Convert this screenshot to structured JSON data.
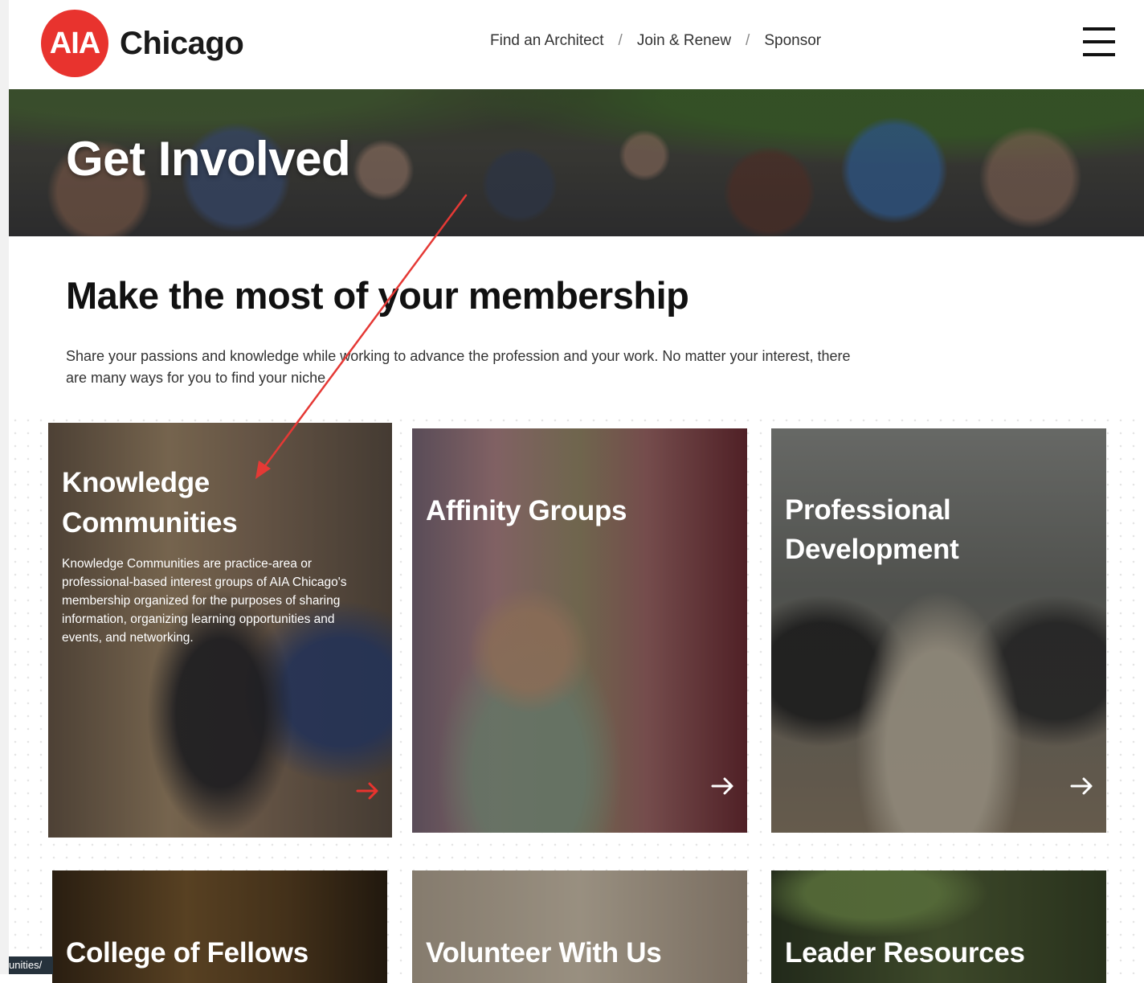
{
  "brand": {
    "logo_mark": "AIA",
    "logo_word": "Chicago",
    "accent": "#e8332e"
  },
  "nav": {
    "items": [
      "Find an Architect",
      "Join & Renew",
      "Sponsor"
    ],
    "separator": "/",
    "menu_icon": "hamburger-menu-icon"
  },
  "hero": {
    "title": "Get Involved"
  },
  "intro": {
    "heading": "Make the most of your membership",
    "text": "Share your passions and knowledge while working to advance the profession and your work. No matter your interest, there are many ways for you to find your niche."
  },
  "cards": [
    {
      "title_line1": "Knowledge",
      "title_line2": "Communities",
      "description": "Knowledge Communities are practice-area or professional-based interest groups of AIA Chicago's membership organized for the purposes of sharing information, organizing learning opportunities and events, and networking.",
      "arrow_color": "#e8332e"
    },
    {
      "title_line1": "Affinity Groups",
      "arrow_color": "#ffffff"
    },
    {
      "title_line1": "Professional",
      "title_line2": "Development",
      "arrow_color": "#ffffff"
    },
    {
      "title_line1": "College of Fellows"
    },
    {
      "title_line1": "Volunteer With Us"
    },
    {
      "title_line1": "Leader Resources"
    }
  ],
  "status_url": "unities/",
  "annotation_color": "#e53935"
}
